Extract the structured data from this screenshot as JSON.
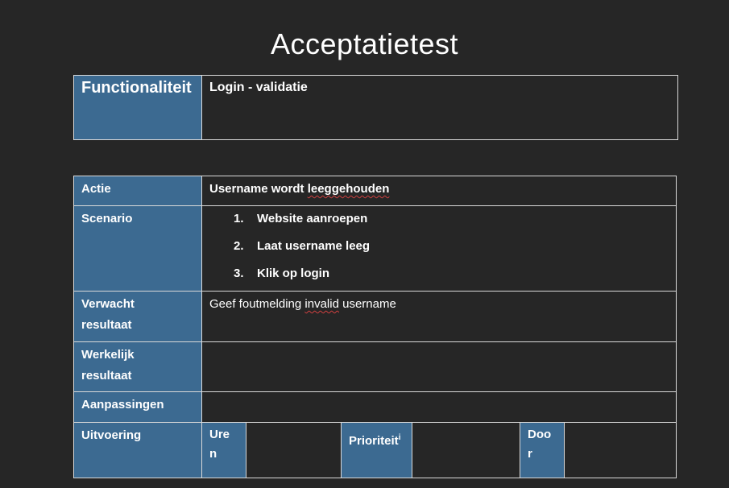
{
  "document": {
    "title": "Acceptatietest"
  },
  "functionality": {
    "label": "Functionaliteit",
    "value": "Login - validatie"
  },
  "test": {
    "actie_label": "Actie",
    "actie_value_pre": "Username wordt ",
    "actie_value_spell": "leeggehouden",
    "scenario_label": "Scenario",
    "scenario_steps": [
      {
        "num": "1.",
        "text": "Website aanroepen"
      },
      {
        "num": "2.",
        "text": "Laat username leeg"
      },
      {
        "num": "3.",
        "text": "Klik op login"
      }
    ],
    "verwacht_label_1": "Verwacht",
    "verwacht_label_2": "resultaat",
    "verwacht_value_pre": "Geef foutmelding ",
    "verwacht_value_spell": "invalid",
    "verwacht_value_post": " username",
    "werkelijk_label_1": "Werkelijk",
    "werkelijk_label_2": "resultaat",
    "aanpassingen_label": "Aanpassingen",
    "uitvoering_label": "Uitvoering",
    "uren_label_1": "Ure",
    "uren_label_2": "n",
    "prioriteit_label": "Prioriteit",
    "prioriteit_sup": "i",
    "door_label_1": "Doo",
    "door_label_2": "r"
  }
}
